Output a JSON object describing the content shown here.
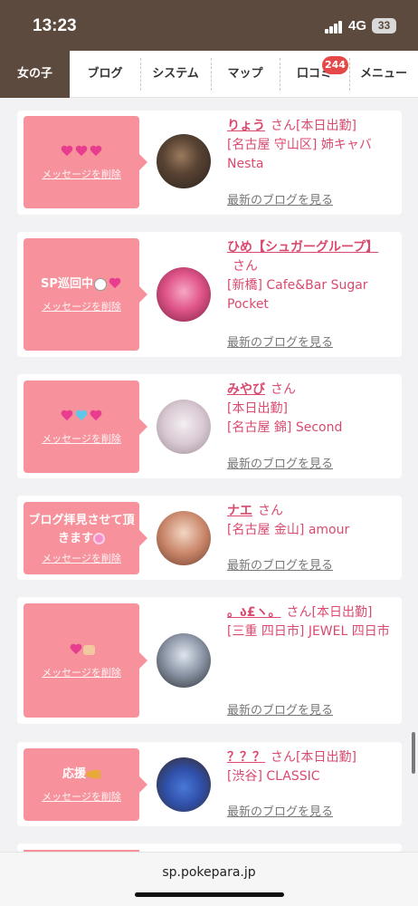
{
  "status": {
    "time": "13:23",
    "network": "4G",
    "battery": "33"
  },
  "tabs": [
    {
      "label": "女の子",
      "active": true
    },
    {
      "label": "ブログ"
    },
    {
      "label": "システム"
    },
    {
      "label": "マップ"
    },
    {
      "label": "口コミ",
      "badge": "244"
    },
    {
      "label": "メニュー"
    }
  ],
  "delete_label": "メッセージを削除",
  "blog_link": "最新のブログを見る",
  "honorific": "さん",
  "cards": [
    {
      "message": "",
      "name": "りょう",
      "line1": "[本日出勤]",
      "line2": "[名古屋 守山区] 姉キャバNesta"
    },
    {
      "message": "SP巡回中",
      "name": "ひめ【シュガーグループ】",
      "line1": "[新橋] Cafe&Bar Sugar Pocket",
      "line2": ""
    },
    {
      "message": "",
      "name": "みやび",
      "line1": "[本日出勤]",
      "line2": "[名古屋 錦] Second"
    },
    {
      "message": "ブログ拝見させて頂きます",
      "name": "ナエ",
      "line1": "[名古屋 金山] amour",
      "line2": ""
    },
    {
      "message": "",
      "name": "。ა£ヽ。",
      "line1": "[本日出勤]",
      "line2": "[三重 四日市] JEWEL 四日市"
    },
    {
      "message": "応援",
      "name": "？？？",
      "line1": "[本日出勤]",
      "line2": "[渋谷] CLASSIC"
    }
  ],
  "url": "sp.pokepara.jp",
  "colors": {
    "header": "#5b4a3d",
    "bubble": "#f7919b",
    "name": "#d94a6e",
    "badge": "#e54848"
  }
}
